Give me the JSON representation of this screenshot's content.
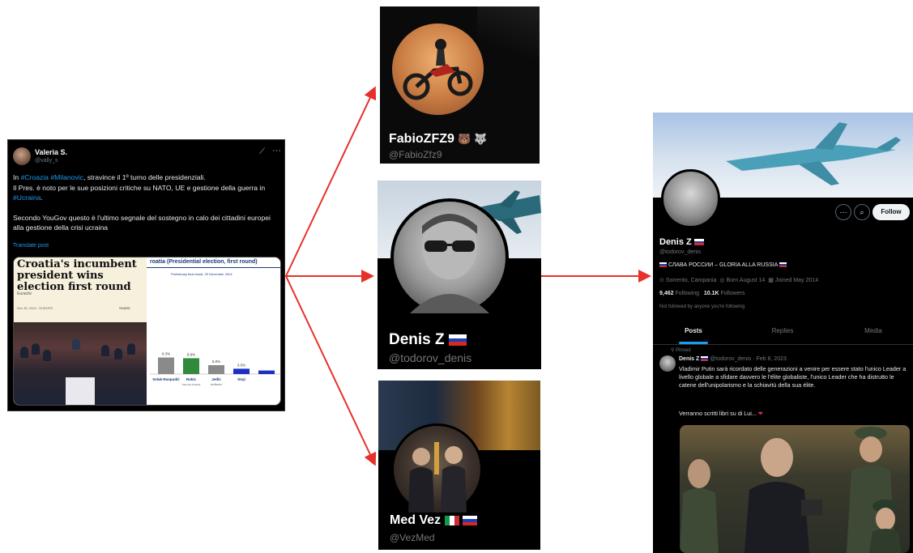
{
  "tweet": {
    "name": "Valeria S.",
    "handle": "@vally_s",
    "more_glyph": "···",
    "body_prefix": "In ",
    "tag_croazia": "#Croazia",
    "tag_milanovic": "#Milanovic",
    "body_line1_rest": ", stravince il 1º turno delle presidenziali.",
    "body_line2_a": "Il Pres. è noto per le sue posizioni critiche su NATO, UE e gestione della guerra in ",
    "tag_ucraina": "#Ucraina",
    "body_line2_end": ".",
    "body_para2": "Secondo YouGov questo è l'ultimo segnale del sostegno in calo dei cittadini europei alla gestione della crisi ucraina",
    "translate": "Translate post",
    "card": {
      "headline": "Croatia's incumbent president wins election first round",
      "author": "Euractiv",
      "date": "Dec 30, 2024 · EUROPE",
      "share": "SHARE",
      "chart_title": "roatia (Presidential election, first round)",
      "chart_subtitle": "Preliminary final result, 29 December 2024"
    }
  },
  "chart_data": {
    "type": "bar",
    "title": "roatia (Presidential election, first round)",
    "subtitle": "Preliminary final result, 29 December 2024",
    "categories": [
      "Selak-Raspudić",
      "Rokic",
      "Jeđić",
      "Stoji",
      ""
    ],
    "category_sublabels": [
      "",
      "Narodna Stranka",
      "MOŽEMO!",
      "",
      ""
    ],
    "values": [
      9.3,
      8.9,
      5.0,
      3.0,
      2.0
    ],
    "value_labels": [
      "9.3%",
      "8.9%",
      "5.0%",
      "3.0%",
      ""
    ],
    "colors": [
      "#8a8a8a",
      "#2f8a3a",
      "#8a8a8a",
      "#1d2fc4",
      "#1d2fc4"
    ],
    "ylim": [
      0,
      50
    ]
  },
  "fabio": {
    "name": "FabioZFZ9",
    "emoji": "🐻 🐺",
    "handle": "@FabioZfz9"
  },
  "denis_card": {
    "name": "Denis Z",
    "handle": "@todorov_denis"
  },
  "medvez": {
    "name": "Med Vez",
    "handle": "@VezMed"
  },
  "profile": {
    "name": "Denis Z",
    "handle": "@todorov_denis",
    "follow": "Follow",
    "bio": "СЛАВА РОССИИ – GLORIA ALLA RUSSIA",
    "location": "Sorrento, Campania",
    "born": "Born August 14",
    "joined": "Joined May 2014",
    "following_count": "9,462",
    "following_label": "Following",
    "followers_count": "10.1K",
    "followers_label": "Followers",
    "not_followed": "Not followed by anyone you're following",
    "tabs": [
      "Posts",
      "Replies",
      "Media"
    ],
    "pinned": "Pinned",
    "post_name": "Denis Z",
    "post_meta": "@todorov_denis · Feb 8, 2023",
    "post_text": "Vladimir Putin sarà ricordato delle generazioni a venire per essere stato l'unico Leader a livello globale a sfidare davvero le l'élite globaliste, l'unico Leader che ha distrutto le catene dell'unipolarismo e la schiavitù della sua élite.",
    "post_text2": "Verranno scritti libri su di Lui...",
    "heart": "❤"
  },
  "colors": {
    "arrow": "#e8302a",
    "link": "#1d9bf0",
    "background": "#ffffff"
  }
}
